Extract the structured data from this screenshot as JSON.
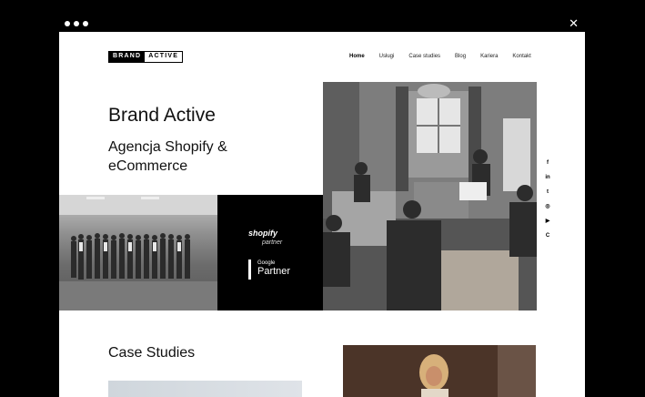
{
  "browser": {
    "close_icon": "close-icon"
  },
  "brand": {
    "logo_left": "BRAND",
    "logo_right": "ACTIVE"
  },
  "nav": [
    {
      "label": "Home",
      "active": true
    },
    {
      "label": "Usługi"
    },
    {
      "label": "Case studies"
    },
    {
      "label": "Blog"
    },
    {
      "label": "Kariera"
    },
    {
      "label": "Kontakt"
    }
  ],
  "hero": {
    "title": "Brand Active",
    "subtitle": "Agencja Shopify & eCommerce"
  },
  "badges": {
    "shopify": "shopify",
    "shopify_sub": "partner",
    "google_small": "Google",
    "google_big": "Partner"
  },
  "social": [
    "facebook-icon",
    "linkedin-icon",
    "twitter-icon",
    "instagram-icon",
    "youtube-icon",
    "clutch-icon"
  ],
  "social_glyphs": [
    "f",
    "in",
    "t",
    "◎",
    "▶",
    "C"
  ],
  "case": {
    "title": "Case Studies"
  },
  "colors": {
    "background": "#ffffff",
    "frame": "#000000",
    "text": "#111111"
  }
}
